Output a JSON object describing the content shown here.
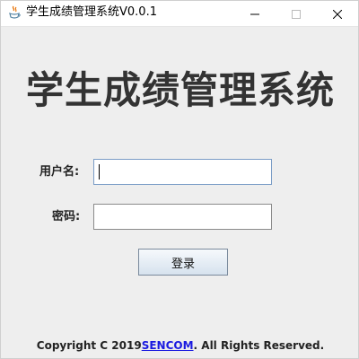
{
  "window": {
    "title": "学生成绩管理系统V0.0.1",
    "app_icon": "java-coffee-cup-icon",
    "controls": {
      "minimize_icon": "minimize-icon",
      "maximize_icon": "maximize-icon",
      "close_icon": "close-icon"
    }
  },
  "login": {
    "heading": "学生成绩管理系统",
    "username_label": "用户名:",
    "username_value": "",
    "password_label": "密码:",
    "password_value": "",
    "login_button": "登录"
  },
  "footer": {
    "prefix": "Copyright C 2019",
    "link": "SENCOM",
    "suffix": ". All Rights Reserved."
  },
  "colors": {
    "background": "#eeeeee",
    "heading": "#333333",
    "link": "#1a1ae0",
    "field_border_active": "#7a9cc6"
  }
}
